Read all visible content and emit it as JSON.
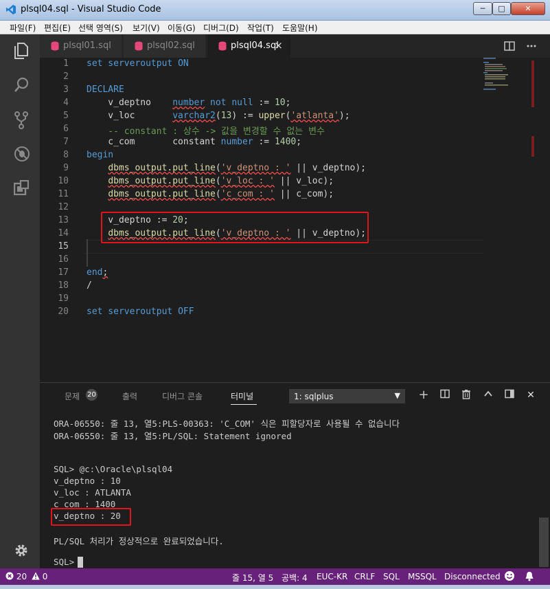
{
  "window": {
    "title": "plsql04.sql - Visual Studio Code",
    "min_label": "─",
    "max_label": "□",
    "close_label": "✕"
  },
  "menu": [
    "파일(F)",
    "편집(E)",
    "선택 영역(S)",
    "보기(V)",
    "이동(G)",
    "디버그(D)",
    "작업(T)",
    "도움말(H)"
  ],
  "tabs": [
    {
      "label": "plsql01.sql",
      "active": false
    },
    {
      "label": "plsql02.sql",
      "active": false
    },
    {
      "label": "plsql04.sql",
      "active": true,
      "close": "×"
    }
  ],
  "editor": {
    "lines": [
      "1",
      "2",
      "3",
      "4",
      "5",
      "6",
      "7",
      "8",
      "9",
      "10",
      "11",
      "12",
      "13",
      "14",
      "15",
      "16",
      "17",
      "18",
      "19",
      "20"
    ],
    "current_line": "15",
    "code": {
      "l1_a": "set serveroutput ",
      "l1_b": "ON",
      "l3": "DECLARE",
      "l4_a": "    v_deptno    ",
      "l4_b": "number",
      "l4_c": " ",
      "l4_d": "not null",
      "l4_e": " := ",
      "l4_f": "10",
      "l4_g": ";",
      "l5_a": "    v_loc       ",
      "l5_b": "varchar2",
      "l5_c": "(",
      "l5_d": "13",
      "l5_e": ") := ",
      "l5_f": "upper",
      "l5_g": "(",
      "l5_h": "'atlanta'",
      "l5_i": ");",
      "l6": "    -- constant : 상수 -> 값을 변경할 수 없는 변수",
      "l7_a": "    c_com       constant ",
      "l7_b": "number",
      "l7_c": " := ",
      "l7_d": "1400",
      "l7_e": ";",
      "l8": "begin",
      "l9_a": "    ",
      "l9_b": "dbms_output.put_line",
      "l9_c": "(",
      "l9_d": "'v_deptno : '",
      "l9_e": " || v_deptno);",
      "l10_a": "    ",
      "l10_b": "dbms_output.put_line",
      "l10_c": "(",
      "l10_d": "'v_loc : '",
      "l10_e": " || v_loc);",
      "l11_a": "    ",
      "l11_b": "dbms_output.put_line",
      "l11_c": "(",
      "l11_d": "'c_com : '",
      "l11_e": " || c_com);",
      "l13_a": "    v_deptno := ",
      "l13_b": "20",
      "l13_c": ";",
      "l14_a": "    ",
      "l14_b": "dbms_output.put_line",
      "l14_c": "(",
      "l14_d": "'v_deptno : '",
      "l14_e": " || v_deptno);",
      "l17_a": "end",
      "l17_b": ";",
      "l18": "/",
      "l20_a": "set serveroutput ",
      "l20_b": "OFF"
    }
  },
  "panel": {
    "tabs": [
      "문제",
      "출력",
      "디버그 콘솔",
      "터미널"
    ],
    "problems_count": "20",
    "terminal_select": "1: sqlplus",
    "icons": [
      "plus-icon",
      "split-icon",
      "trash-icon",
      "chevron-up-icon",
      "maximize-icon",
      "close-icon"
    ],
    "terminal_lines": [
      "ORA-06550: 줄 13, 열5:PLS-00363: 'C_COM' 식은 피할당자로 사용될 수 없습니다",
      "ORA-06550: 줄 13, 열5:PL/SQL: Statement ignored",
      "SQL> @c:\\Oracle\\plsql04",
      "v_deptno : 10",
      "v_loc : ATLANTA",
      "c_com : 1400",
      "v_deptno : 20",
      "PL/SQL 처리가 정상적으로 완료되었습니다.",
      "SQL> "
    ]
  },
  "status": {
    "errors": "20",
    "warnings": "0",
    "position": "줄 15, 열 5",
    "indent": "공백: 4",
    "encoding": "EUC-KR",
    "eol": "CRLF",
    "language": "SQL",
    "dialect": "MSSQL",
    "connection": "Disconnected"
  },
  "colors": {
    "statusbar": "#68217a",
    "highlight_box": "#e0141c",
    "keyword": "#569cd6",
    "string": "#ce9178"
  }
}
